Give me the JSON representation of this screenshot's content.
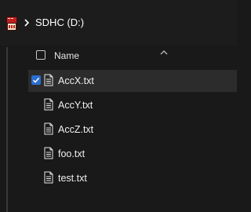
{
  "breadcrumb": {
    "location": "SDHC (D:)"
  },
  "column_header": {
    "name_label": "Name"
  },
  "files": [
    {
      "name": "AccX.txt",
      "selected": true
    },
    {
      "name": "AccY.txt",
      "selected": false
    },
    {
      "name": "AccZ.txt",
      "selected": false
    },
    {
      "name": "foo.txt",
      "selected": false
    },
    {
      "name": "test.txt",
      "selected": false
    }
  ],
  "icons": {
    "drive": "sd-card-drive-icon",
    "chevron": "chevron-right-icon",
    "sort": "sort-ascending-icon",
    "file": "text-file-icon",
    "check": "checkmark-icon"
  },
  "colors": {
    "background": "#191919",
    "selection": "#2c2c2c",
    "checkbox_accent": "#2a6ed0"
  }
}
